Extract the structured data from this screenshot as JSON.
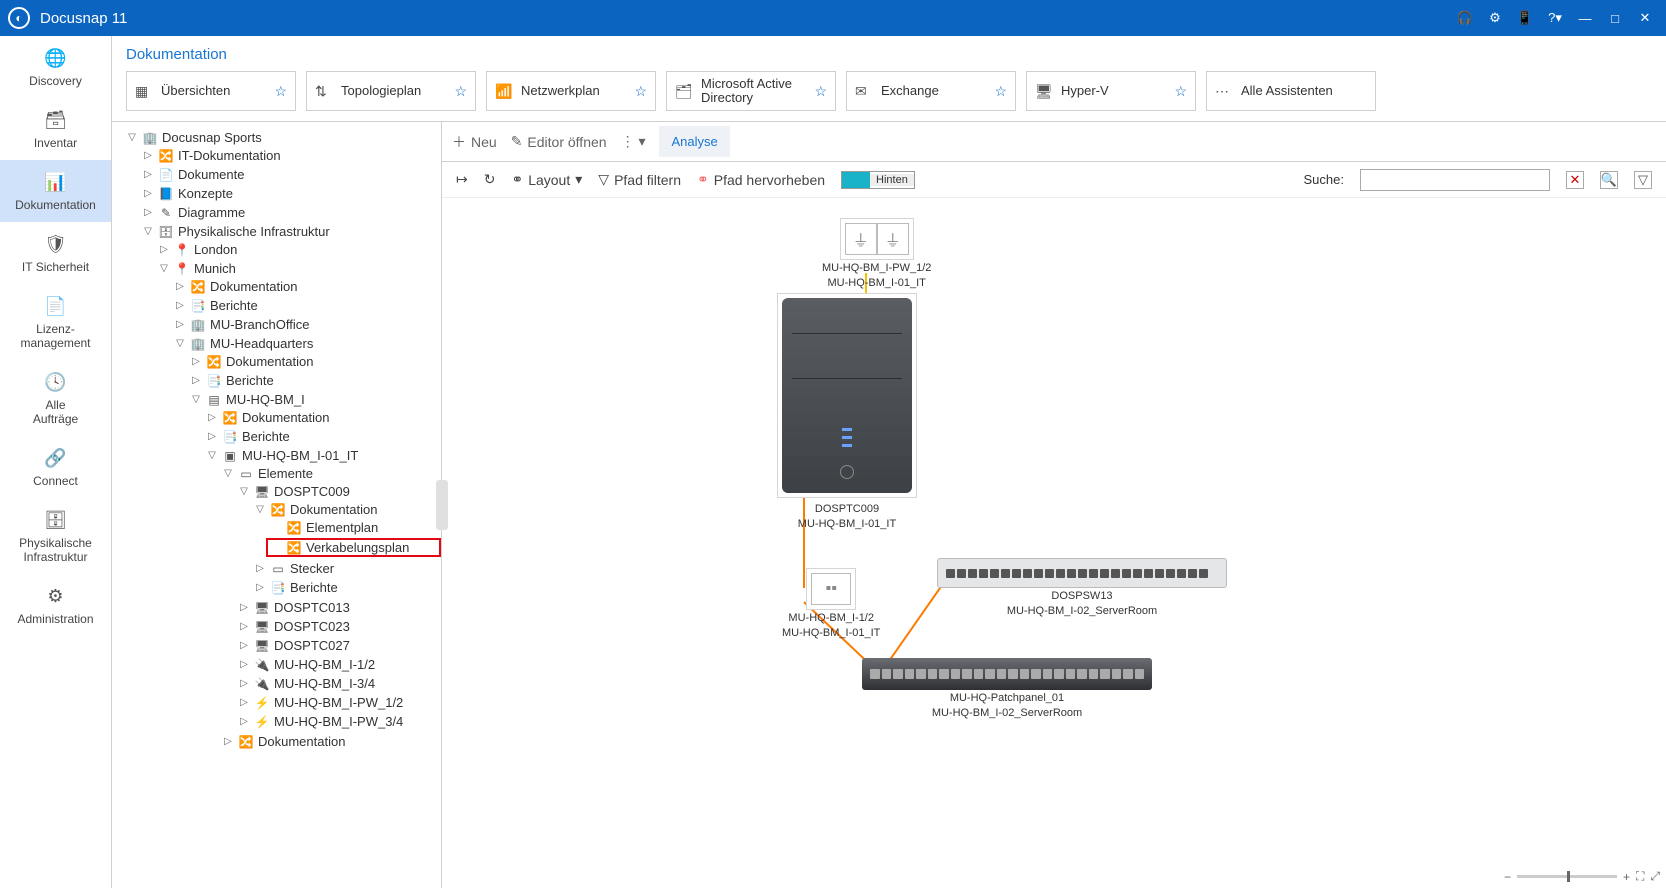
{
  "app": {
    "title": "Docusnap 11"
  },
  "vnav": [
    {
      "label": "Discovery"
    },
    {
      "label": "Inventar"
    },
    {
      "label": "Dokumentation"
    },
    {
      "label": "IT Sicherheit"
    },
    {
      "label": "Lizenz-\nmanagement"
    },
    {
      "label": "Alle\nAufträge"
    },
    {
      "label": "Connect"
    },
    {
      "label": "Physikalische\nInfrastruktur"
    },
    {
      "label": "Administration"
    }
  ],
  "breadcrumb": "Dokumentation",
  "tiles": [
    {
      "label": "Übersichten"
    },
    {
      "label": "Topologieplan"
    },
    {
      "label": "Netzwerkplan"
    },
    {
      "label": "Microsoft Active Directory"
    },
    {
      "label": "Exchange"
    },
    {
      "label": "Hyper-V"
    },
    {
      "label": "Alle Assistenten",
      "more": true
    }
  ],
  "actions": {
    "new": "Neu",
    "editor": "Editor öffnen",
    "tab": "Analyse"
  },
  "dtoolbar": {
    "layout": "Layout",
    "filter": "Pfad filtern",
    "highlight": "Pfad hervorheben",
    "legend": "Hinten",
    "searchlbl": "Suche:"
  },
  "tree": {
    "root": "Docusnap Sports",
    "itdoc": "IT-Dokumentation",
    "dokumente": "Dokumente",
    "konzepte": "Konzepte",
    "diagramme": "Diagramme",
    "phys": "Physikalische Infrastruktur",
    "london": "London",
    "munich": "Munich",
    "dokumentation": "Dokumentation",
    "berichte": "Berichte",
    "branch": "MU-BranchOffice",
    "hq": "MU-Headquarters",
    "bm": "MU-HQ-BM_I",
    "room": "MU-HQ-BM_I-01_IT",
    "elemente": "Elemente",
    "pc009": "DOSPTC009",
    "elementplan": "Elementplan",
    "verkabel": "Verkabelungsplan",
    "stecker": "Stecker",
    "pc013": "DOSPTC013",
    "pc023": "DOSPTC023",
    "pc027": "DOSPTC027",
    "i12": "MU-HQ-BM_I-1/2",
    "i34": "MU-HQ-BM_I-3/4",
    "pw12": "MU-HQ-BM_I-PW_1/2",
    "pw34": "MU-HQ-BM_I-PW_3/4"
  },
  "diagram": {
    "outlet": {
      "l1": "MU-HQ-BM_I-PW_1/2",
      "l2": "MU-HQ-BM_I-01_IT"
    },
    "pc": {
      "l1": "DOSPTC009",
      "l2": "MU-HQ-BM_I-01_IT"
    },
    "wall": {
      "l1": "MU-HQ-BM_I-1/2",
      "l2": "MU-HQ-BM_I-01_IT"
    },
    "switch": {
      "l1": "DOSPSW13",
      "l2": "MU-HQ-BM_I-02_ServerRoom"
    },
    "patch": {
      "l1": "MU-HQ-Patchpanel_01",
      "l2": "MU-HQ-BM_I-02_ServerRoom"
    }
  }
}
